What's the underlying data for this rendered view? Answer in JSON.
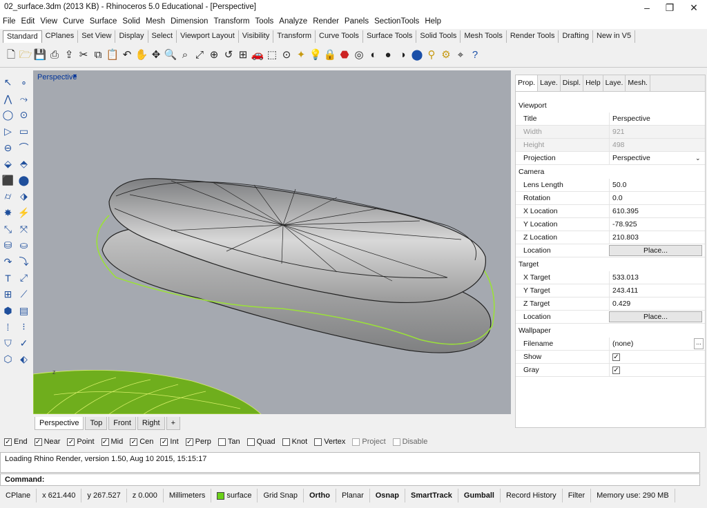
{
  "window": {
    "title": "02_surface.3dm (2013 KB) - Rhinoceros 5.0 Educational - [Perspective]"
  },
  "menu": [
    "File",
    "Edit",
    "View",
    "Curve",
    "Surface",
    "Solid",
    "Mesh",
    "Dimension",
    "Transform",
    "Tools",
    "Analyze",
    "Render",
    "Panels",
    "SectionTools",
    "Help"
  ],
  "toolbar_tabs": [
    "Standard",
    "CPlanes",
    "Set View",
    "Display",
    "Select",
    "Viewport Layout",
    "Visibility",
    "Transform",
    "Curve Tools",
    "Surface Tools",
    "Solid Tools",
    "Mesh Tools",
    "Render Tools",
    "Drafting",
    "New in V5"
  ],
  "viewport": {
    "label": "Perspective"
  },
  "viewport_tabs": [
    "Perspective",
    "Top",
    "Front",
    "Right",
    "+"
  ],
  "panel_tabs": [
    "Prop.",
    "Laye.",
    "Displ.",
    "Help",
    "Laye.",
    "Mesh."
  ],
  "properties": {
    "viewport_section": "Viewport",
    "title_k": "Title",
    "title_v": "Perspective",
    "width_k": "Width",
    "width_v": "921",
    "height_k": "Height",
    "height_v": "498",
    "projection_k": "Projection",
    "projection_v": "Perspective",
    "camera_section": "Camera",
    "lens_k": "Lens Length",
    "lens_v": "50.0",
    "rotation_k": "Rotation",
    "rotation_v": "0.0",
    "xloc_k": "X Location",
    "xloc_v": "610.395",
    "yloc_k": "Y Location",
    "yloc_v": "-78.925",
    "zloc_k": "Z Location",
    "zloc_v": "210.803",
    "loc_k": "Location",
    "place": "Place...",
    "target_section": "Target",
    "xt_k": "X Target",
    "xt_v": "533.013",
    "yt_k": "Y Target",
    "yt_v": "243.411",
    "zt_k": "Z Target",
    "zt_v": "0.429",
    "tloc_k": "Location",
    "wallpaper_section": "Wallpaper",
    "file_k": "Filename",
    "file_v": "(none)",
    "dots": "...",
    "show_k": "Show",
    "gray_k": "Gray"
  },
  "osnap": [
    {
      "label": "End",
      "checked": true
    },
    {
      "label": "Near",
      "checked": true
    },
    {
      "label": "Point",
      "checked": true
    },
    {
      "label": "Mid",
      "checked": true
    },
    {
      "label": "Cen",
      "checked": true
    },
    {
      "label": "Int",
      "checked": true
    },
    {
      "label": "Perp",
      "checked": true
    },
    {
      "label": "Tan",
      "checked": false
    },
    {
      "label": "Quad",
      "checked": false
    },
    {
      "label": "Knot",
      "checked": false
    },
    {
      "label": "Vertex",
      "checked": false
    },
    {
      "label": "Project",
      "checked": false,
      "disabled": true
    },
    {
      "label": "Disable",
      "checked": false,
      "disabled": true
    }
  ],
  "history": "Loading Rhino Render, version 1.50, Aug 10 2015, 15:15:17",
  "command": "Command:",
  "status": {
    "cplane": "CPlane",
    "x": "x 621.440",
    "y": "y 267.527",
    "z": "z 0.000",
    "units": "Millimeters",
    "layer": "surface",
    "gridsnap": "Grid Snap",
    "ortho": "Ortho",
    "planar": "Planar",
    "osnap": "Osnap",
    "smarttrack": "SmartTrack",
    "gumball": "Gumball",
    "history": "Record History",
    "filter": "Filter",
    "memory": "Memory use: 290 MB"
  },
  "colors": {
    "viewport_bg": "#a5a9b0",
    "layer_color": "#6bd11a",
    "accent": "#1a4fa8"
  }
}
